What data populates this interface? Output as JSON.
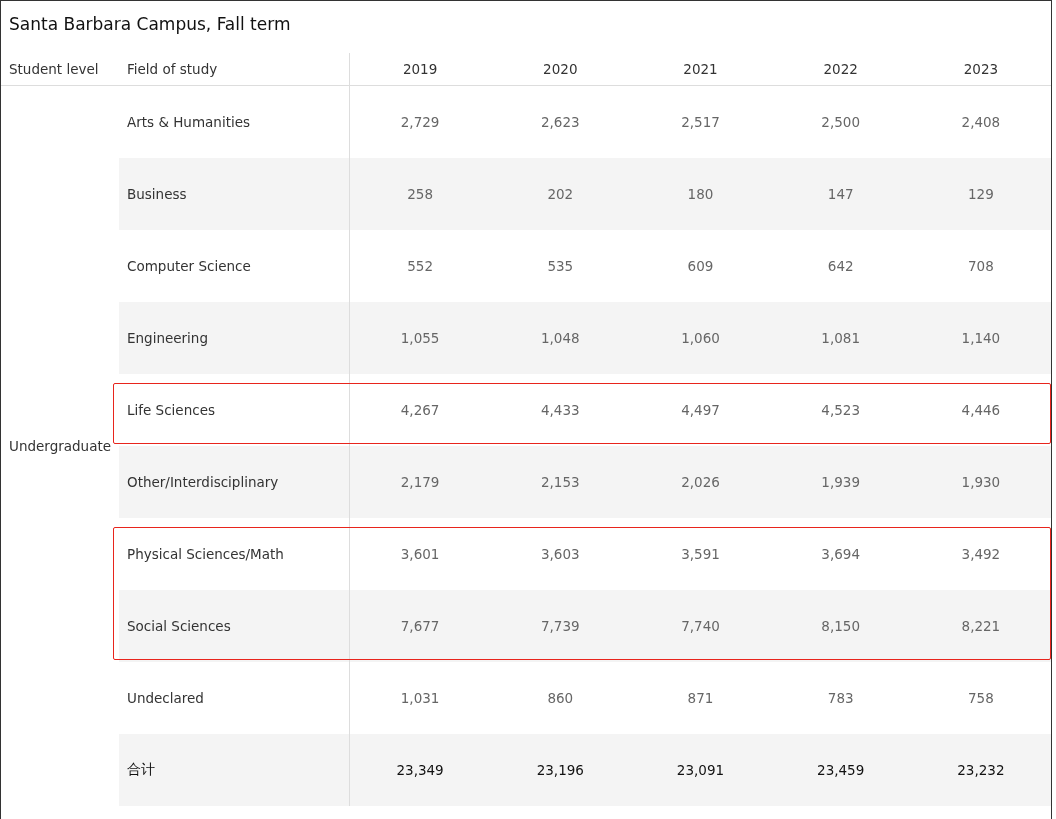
{
  "title": "Santa Barbara Campus, Fall term",
  "columns": {
    "level": "Student level",
    "field": "Field of study",
    "years": [
      "2019",
      "2020",
      "2021",
      "2022",
      "2023"
    ]
  },
  "group": {
    "label": "Undergraduate"
  },
  "rows": [
    {
      "kind": "data",
      "field": "Arts & Humanities",
      "values": [
        "2,729",
        "2,623",
        "2,517",
        "2,500",
        "2,408"
      ],
      "highlighted": false
    },
    {
      "kind": "data",
      "field": "Business",
      "values": [
        "258",
        "202",
        "180",
        "147",
        "129"
      ],
      "highlighted": false
    },
    {
      "kind": "data",
      "field": "Computer Science",
      "values": [
        "552",
        "535",
        "609",
        "642",
        "708"
      ],
      "highlighted": false
    },
    {
      "kind": "data",
      "field": "Engineering",
      "values": [
        "1,055",
        "1,048",
        "1,060",
        "1,081",
        "1,140"
      ],
      "highlighted": false
    },
    {
      "kind": "data",
      "field": "Life Sciences",
      "values": [
        "4,267",
        "4,433",
        "4,497",
        "4,523",
        "4,446"
      ],
      "highlighted": true
    },
    {
      "kind": "data",
      "field": "Other/Interdisciplinary",
      "values": [
        "2,179",
        "2,153",
        "2,026",
        "1,939",
        "1,930"
      ],
      "highlighted": false
    },
    {
      "kind": "data",
      "field": "Physical Sciences/Math",
      "values": [
        "3,601",
        "3,603",
        "3,591",
        "3,694",
        "3,492"
      ],
      "highlighted": true
    },
    {
      "kind": "data",
      "field": "Social Sciences",
      "values": [
        "7,677",
        "7,739",
        "7,740",
        "8,150",
        "8,221"
      ],
      "highlighted": true
    },
    {
      "kind": "data",
      "field": "Undeclared",
      "values": [
        "1,031",
        "860",
        "871",
        "783",
        "758"
      ],
      "highlighted": false
    },
    {
      "kind": "total",
      "field": "合计",
      "values": [
        "23,349",
        "23,196",
        "23,091",
        "23,459",
        "23,232"
      ],
      "highlighted": false
    }
  ]
}
